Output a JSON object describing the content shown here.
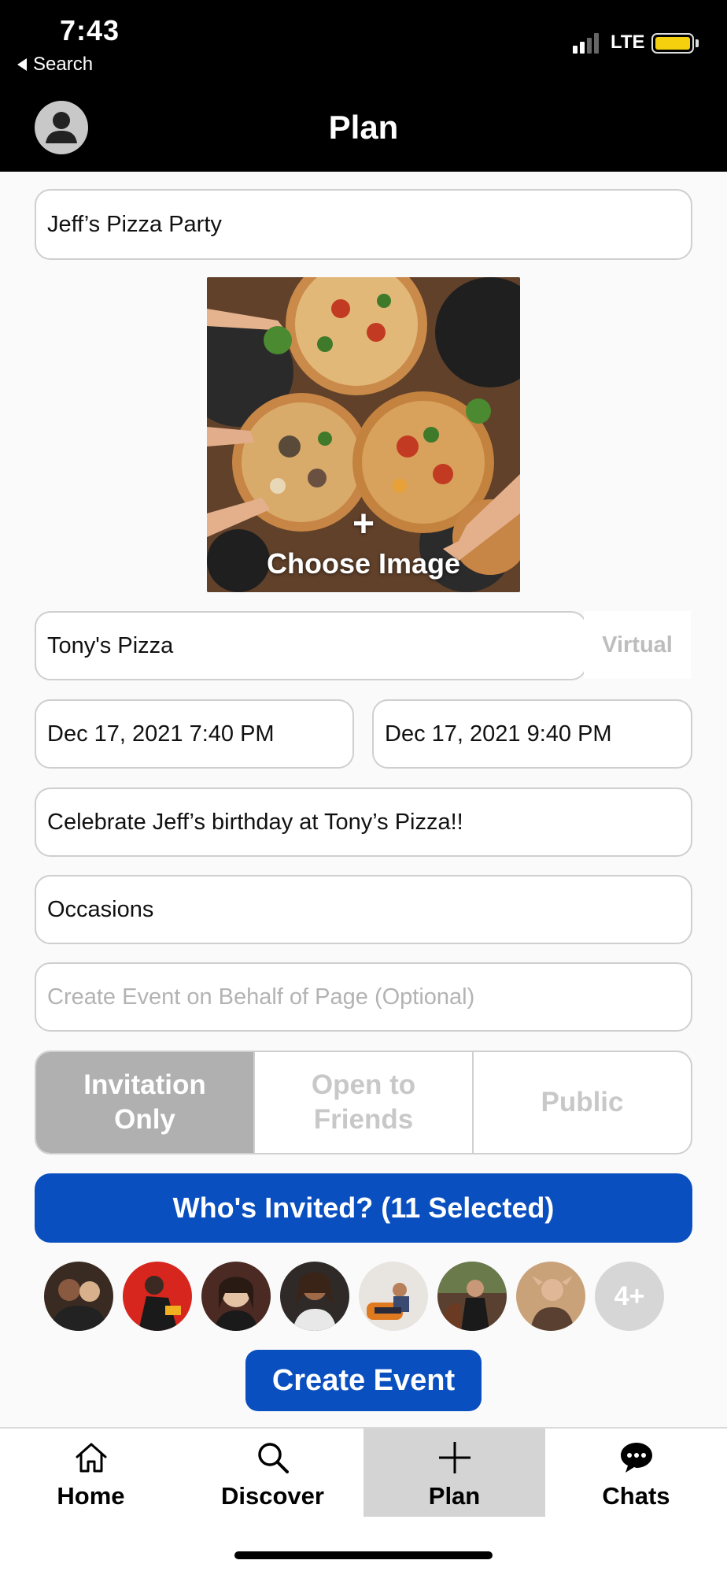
{
  "status_bar": {
    "time": "7:43",
    "back_label": "Search",
    "network": "LTE",
    "battery_color": "#f5d00f"
  },
  "header": {
    "title": "Plan"
  },
  "form": {
    "event_name": "Jeff’s Pizza Party",
    "image_plus": "+",
    "choose_image_label": "Choose Image",
    "location": "Tony's Pizza",
    "virtual_label": "Virtual",
    "start_datetime": "Dec 17, 2021 7:40 PM",
    "end_datetime": "Dec 17, 2021 9:40 PM",
    "description": "Celebrate Jeff’s birthday at Tony’s Pizza!!",
    "category": "Occasions",
    "page_placeholder": "Create Event on Behalf of Page (Optional)"
  },
  "privacy": {
    "options": [
      "Invitation Only",
      "Open to Friends",
      "Public"
    ],
    "selected": "Invitation Only"
  },
  "invited": {
    "button_label": "Who's Invited? (11 Selected)",
    "more_label": "4+",
    "avatar_colors": [
      "#3a2b22",
      "#d7261e",
      "#4a2a22",
      "#2f2a28",
      "#e8e4df",
      "#5a4030",
      "#c9a27a"
    ]
  },
  "create_button_label": "Create Event",
  "tabs": [
    {
      "label": "Home",
      "icon": "home-icon"
    },
    {
      "label": "Discover",
      "icon": "search-icon"
    },
    {
      "label": "Plan",
      "icon": "plus-icon"
    },
    {
      "label": "Chats",
      "icon": "chat-bubble-icon"
    }
  ],
  "active_tab": "Plan",
  "colors": {
    "accent": "#0a4fbf",
    "header_bg": "#000000",
    "segment_selected": "#b0b0b0"
  }
}
